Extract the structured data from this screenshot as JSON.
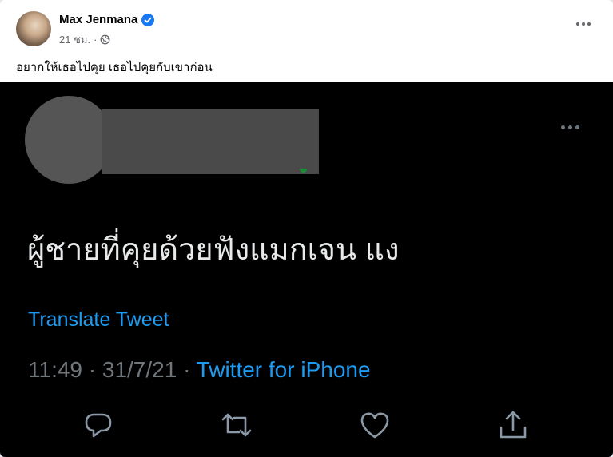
{
  "post": {
    "author": "Max Jenmana",
    "time": "21 ชม.",
    "separator": "·",
    "caption": "อยากให้เธอไปคุย เธอไปคุยกับเขาก่อน"
  },
  "tweet": {
    "text": "ผู้ชายที่คุยด้วยฟังแมกเจน แง",
    "translate_label": "Translate Tweet",
    "timestamp": "11:49 · 31/7/21 · ",
    "source": "Twitter for iPhone"
  },
  "colors": {
    "verified_blue": "#1877f2",
    "twitter_blue": "#1d9bf0",
    "tweet_bg": "#000000"
  },
  "icons": [
    "verified-badge-icon",
    "globe-icon",
    "more-icon",
    "reply-icon",
    "retweet-icon",
    "like-icon",
    "share-icon"
  ]
}
